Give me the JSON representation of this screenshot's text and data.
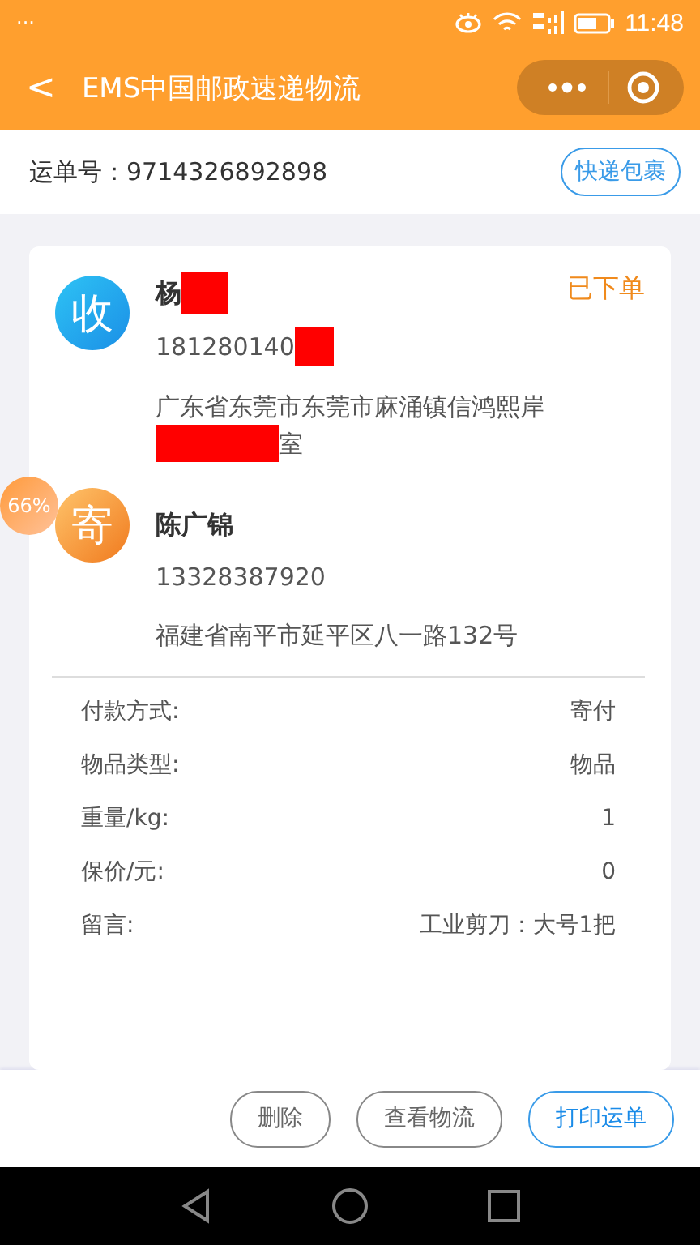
{
  "status_bar": {
    "dots": "···",
    "time": "11:48"
  },
  "nav": {
    "back": "<",
    "title": "EMS中国邮政速递物流"
  },
  "waybill": {
    "label": "运单号：",
    "number": "9714326892898",
    "tag": "快递包裹"
  },
  "status": "已下单",
  "parties": [
    {
      "kind": "receiver",
      "badge": "收",
      "name": "杨",
      "name_redacted": true,
      "phone": "181280140",
      "phone_redacted": true,
      "address": "广东省东莞市东莞市麻涌镇信鸿熙岸",
      "address_tail": "室",
      "address_redacted": true
    },
    {
      "kind": "sender",
      "badge": "寄",
      "name": "陈广锦",
      "name_redacted": false,
      "phone": "13328387920",
      "phone_redacted": false,
      "address": "福建省南平市延平区八一路132号",
      "address_redacted": false
    }
  ],
  "details": [
    {
      "label": "付款方式:",
      "value": "寄付"
    },
    {
      "label": "物品类型:",
      "value": "物品"
    },
    {
      "label": "重量/kg:",
      "value": "1"
    },
    {
      "label": "保价/元:",
      "value": "0"
    },
    {
      "label": "留言:",
      "value": "工业剪刀：大号1把"
    }
  ],
  "float_badge": "66%",
  "buttons": [
    {
      "label": "删除",
      "primary": false
    },
    {
      "label": "查看物流",
      "primary": false
    },
    {
      "label": "打印运单",
      "primary": true
    }
  ]
}
